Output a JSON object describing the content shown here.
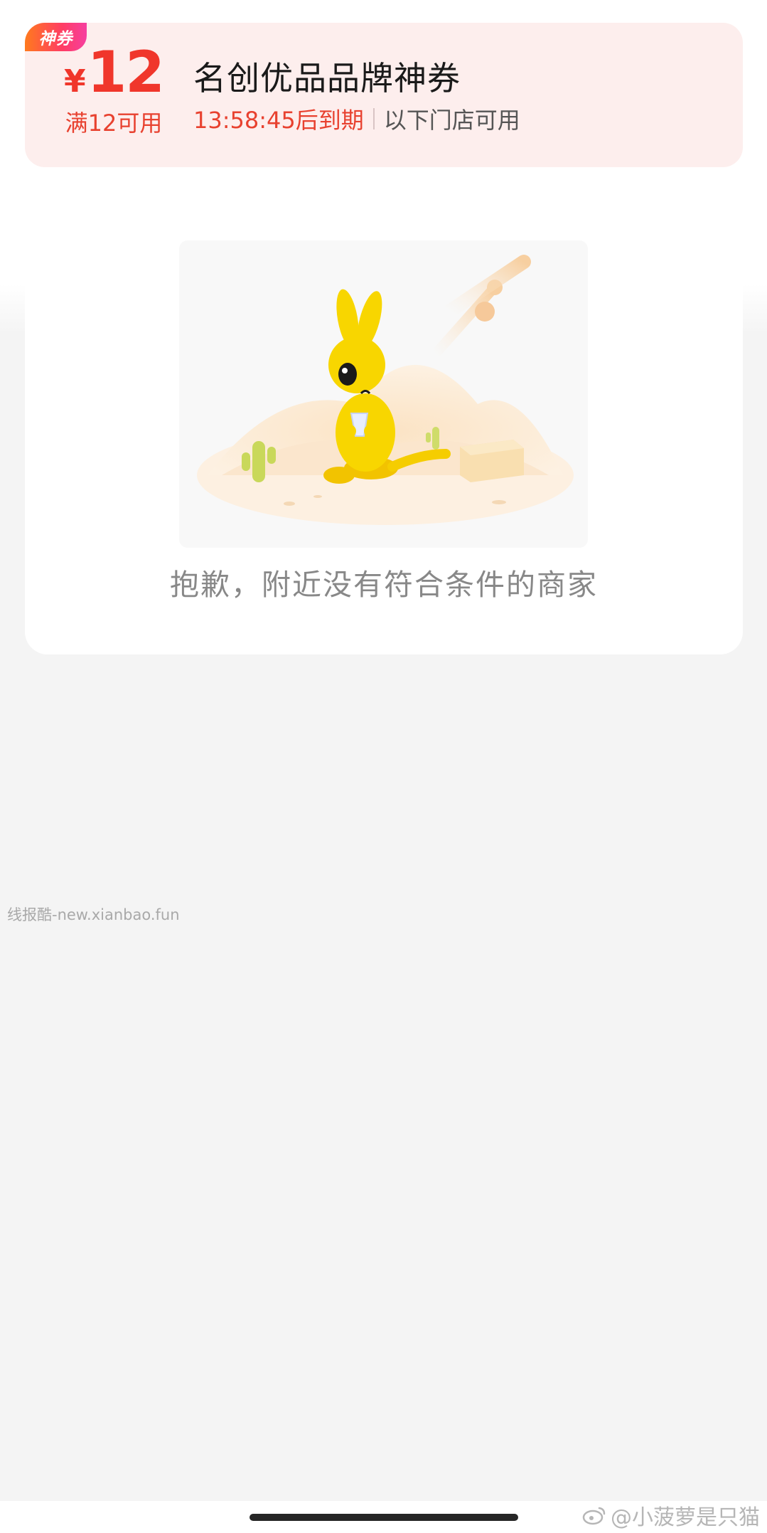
{
  "coupon": {
    "tag": "神券",
    "currency": "¥",
    "amount": "12",
    "condition": "满12可用",
    "title": "名创优品品牌神券",
    "countdown": "13:58:45后到期",
    "stores_text": "以下门店可用"
  },
  "empty_state": {
    "message": "抱歉，附近没有符合条件的商家"
  },
  "watermark": {
    "left_text": "线报酷-new.xianbao.fun",
    "credit_text": "@小菠萝是只猫"
  },
  "colors": {
    "accent_red": "#f0362b",
    "coupon_bg": "#fdeeed",
    "page_bg": "#f4f4f4"
  }
}
